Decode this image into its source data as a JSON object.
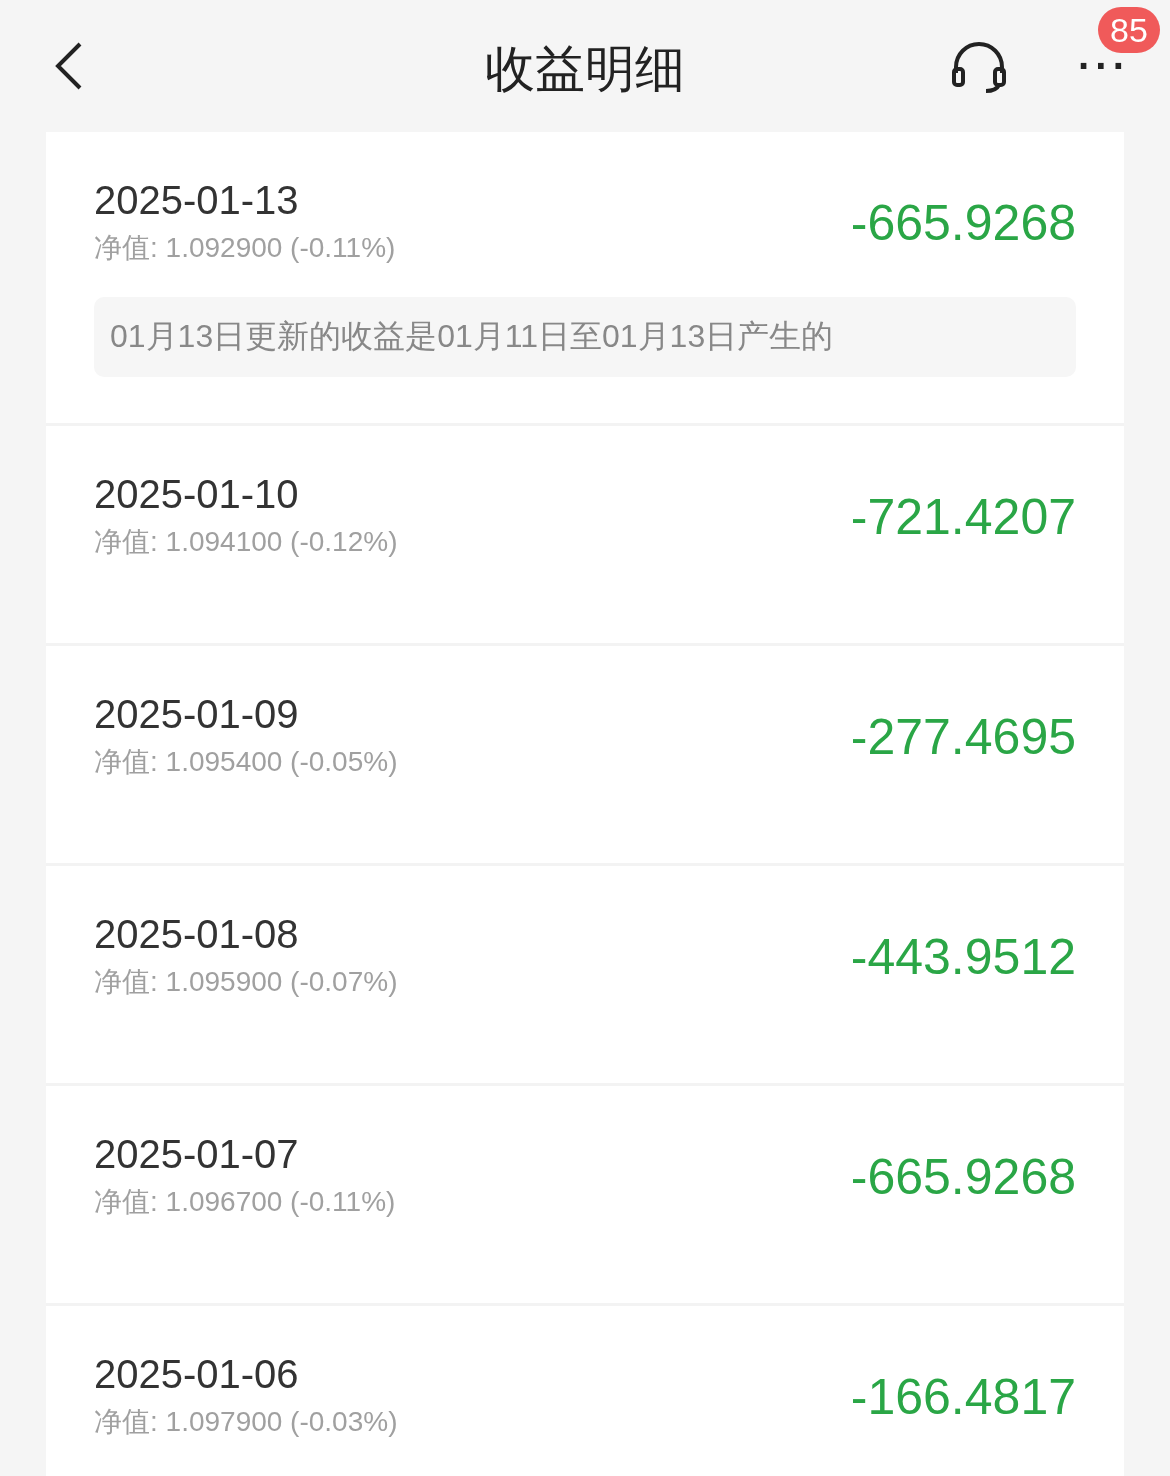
{
  "header": {
    "title": "收益明细",
    "more": "···",
    "badge": "85"
  },
  "records": [
    {
      "date": "2025-01-13",
      "nav": "净值: 1.092900 (-0.11%)",
      "amount": "-665.9268",
      "note": "01月13日更新的收益是01月11日至01月13日产生的"
    },
    {
      "date": "2025-01-10",
      "nav": "净值: 1.094100 (-0.12%)",
      "amount": "-721.4207"
    },
    {
      "date": "2025-01-09",
      "nav": "净值: 1.095400 (-0.05%)",
      "amount": "-277.4695"
    },
    {
      "date": "2025-01-08",
      "nav": "净值: 1.095900 (-0.07%)",
      "amount": "-443.9512"
    },
    {
      "date": "2025-01-07",
      "nav": "净值: 1.096700 (-0.11%)",
      "amount": "-665.9268"
    },
    {
      "date": "2025-01-06",
      "nav": "净值: 1.097900 (-0.03%)",
      "amount": "-166.4817"
    }
  ]
}
